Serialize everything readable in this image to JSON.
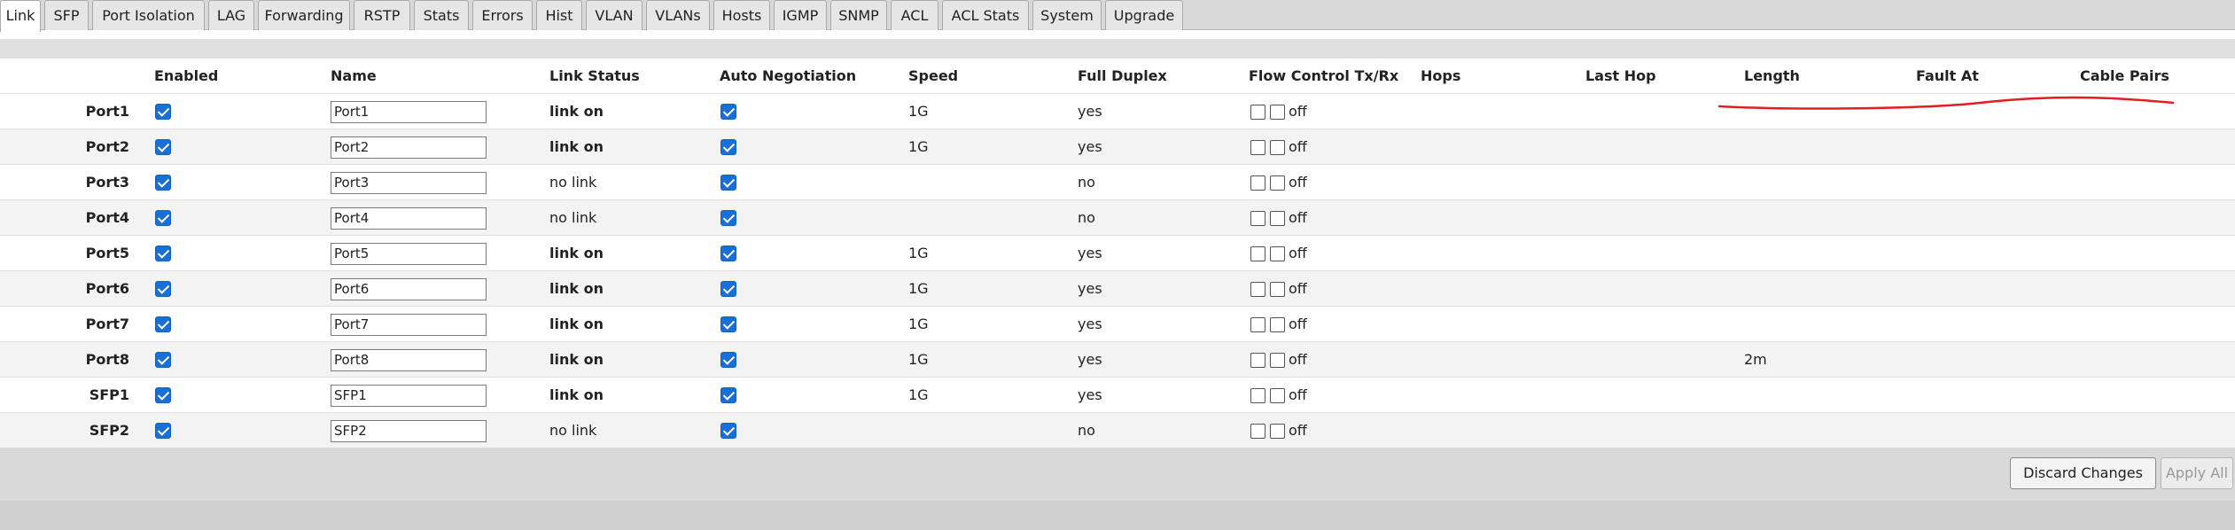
{
  "tabs": [
    {
      "label": "Link",
      "active": true
    },
    {
      "label": "SFP"
    },
    {
      "label": "Port Isolation"
    },
    {
      "label": "LAG"
    },
    {
      "label": "Forwarding"
    },
    {
      "label": "RSTP"
    },
    {
      "label": "Stats"
    },
    {
      "label": "Errors"
    },
    {
      "label": "Hist"
    },
    {
      "label": "VLAN"
    },
    {
      "label": "VLANs"
    },
    {
      "label": "Hosts"
    },
    {
      "label": "IGMP"
    },
    {
      "label": "SNMP"
    },
    {
      "label": "ACL"
    },
    {
      "label": "ACL Stats"
    },
    {
      "label": "System"
    },
    {
      "label": "Upgrade"
    }
  ],
  "columns": {
    "enabled": "Enabled",
    "name": "Name",
    "link_status": "Link Status",
    "auto_negotiation": "Auto Negotiation",
    "speed": "Speed",
    "full_duplex": "Full Duplex",
    "flow_control": "Flow Control Tx/Rx",
    "hops": "Hops",
    "last_hop": "Last Hop",
    "length": "Length",
    "fault_at": "Fault At",
    "cable_pairs": "Cable Pairs"
  },
  "rows": [
    {
      "port": "Port1",
      "enabled": true,
      "name": "Port1",
      "link_status": "link on",
      "link_on": true,
      "auto_neg": true,
      "speed": "1G",
      "full_duplex": "yes",
      "flow": "off",
      "length": ""
    },
    {
      "port": "Port2",
      "enabled": true,
      "name": "Port2",
      "link_status": "link on",
      "link_on": true,
      "auto_neg": true,
      "speed": "1G",
      "full_duplex": "yes",
      "flow": "off",
      "length": ""
    },
    {
      "port": "Port3",
      "enabled": true,
      "name": "Port3",
      "link_status": "no link",
      "link_on": false,
      "auto_neg": true,
      "speed": "",
      "full_duplex": "no",
      "flow": "off",
      "length": ""
    },
    {
      "port": "Port4",
      "enabled": true,
      "name": "Port4",
      "link_status": "no link",
      "link_on": false,
      "auto_neg": true,
      "speed": "",
      "full_duplex": "no",
      "flow": "off",
      "length": ""
    },
    {
      "port": "Port5",
      "enabled": true,
      "name": "Port5",
      "link_status": "link on",
      "link_on": true,
      "auto_neg": true,
      "speed": "1G",
      "full_duplex": "yes",
      "flow": "off",
      "length": ""
    },
    {
      "port": "Port6",
      "enabled": true,
      "name": "Port6",
      "link_status": "link on",
      "link_on": true,
      "auto_neg": true,
      "speed": "1G",
      "full_duplex": "yes",
      "flow": "off",
      "length": ""
    },
    {
      "port": "Port7",
      "enabled": true,
      "name": "Port7",
      "link_status": "link on",
      "link_on": true,
      "auto_neg": true,
      "speed": "1G",
      "full_duplex": "yes",
      "flow": "off",
      "length": ""
    },
    {
      "port": "Port8",
      "enabled": true,
      "name": "Port8",
      "link_status": "link on",
      "link_on": true,
      "auto_neg": true,
      "speed": "1G",
      "full_duplex": "yes",
      "flow": "off",
      "length": "2m"
    },
    {
      "port": "SFP1",
      "enabled": true,
      "name": "SFP1",
      "link_status": "link on",
      "link_on": true,
      "auto_neg": true,
      "speed": "1G",
      "full_duplex": "yes",
      "flow": "off",
      "length": ""
    },
    {
      "port": "SFP2",
      "enabled": true,
      "name": "SFP2",
      "link_status": "no link",
      "link_on": false,
      "auto_neg": true,
      "speed": "",
      "full_duplex": "no",
      "flow": "off",
      "length": ""
    }
  ],
  "buttons": {
    "discard": "Discard Changes",
    "apply": "Apply All"
  },
  "colors": {
    "checkbox": "#1a6ed8",
    "annotation": "#e02020"
  },
  "icons": [
    "checkbox-checked-icon",
    "checkbox-unchecked-icon"
  ]
}
